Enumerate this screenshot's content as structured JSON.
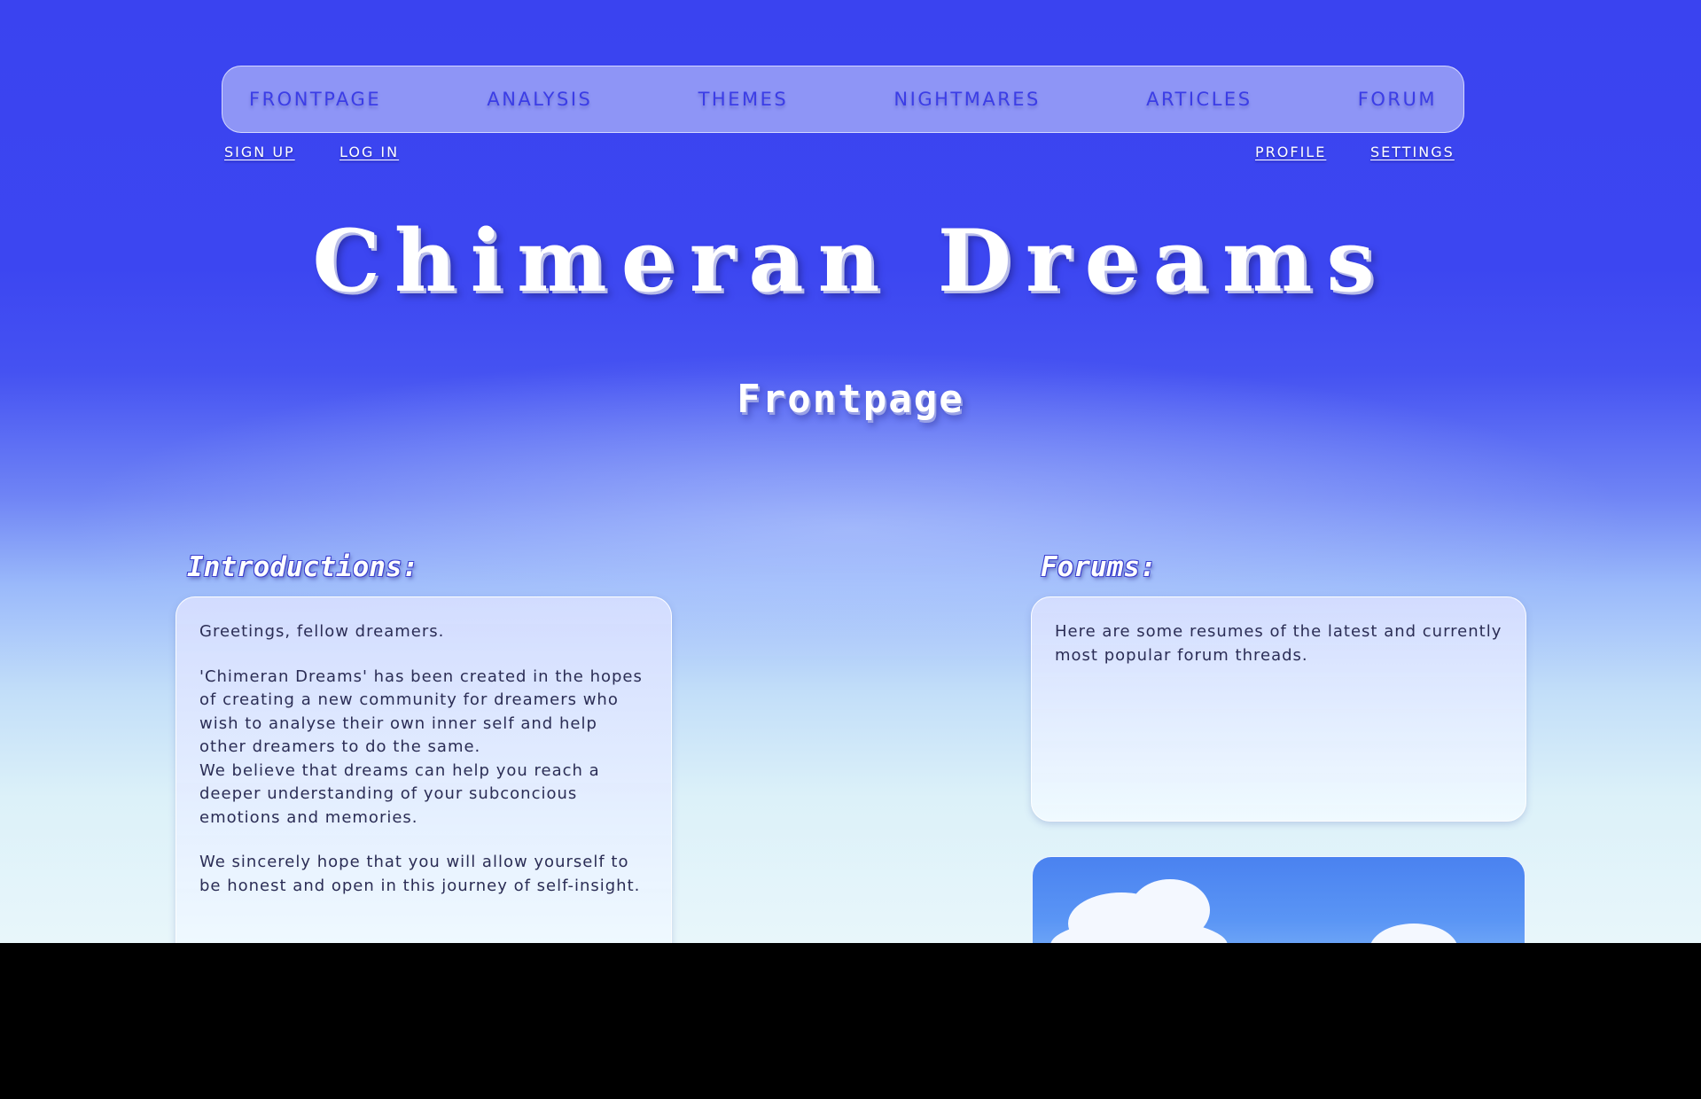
{
  "nav": {
    "items": [
      "FRONTPAGE",
      "ANALYSIS",
      "THEMES",
      "NIGHTMARES",
      "ARTICLES",
      "FORUM"
    ]
  },
  "account": {
    "sign_up": "SIGN UP",
    "log_in": "LOG IN",
    "profile": "PROFILE",
    "settings": "SETTINGS"
  },
  "header": {
    "site_title": "Chimeran Dreams",
    "page_title": "Frontpage"
  },
  "introductions": {
    "heading": "Introductions:",
    "greeting": "Greetings, fellow dreamers.",
    "paragraph_1": "'Chimeran Dreams' has been created in the hopes of creating a new community for dreamers who wish to analyse their own inner self and help other dreamers to do the same.",
    "paragraph_2": "We believe that dreams can help you reach a deeper understanding of your subconcious emotions and memories.",
    "paragraph_3": "We sincerely hope that you will allow yourself to be honest and open in this journey of self-insight."
  },
  "forums": {
    "heading": "Forums:",
    "intro": "Here are some resumes of the latest and currently most popular forum threads."
  },
  "colors": {
    "background_top": "#3a43f0",
    "background_bottom": "#e8f6fa",
    "nav_text": "#3b3de6",
    "card_text": "#2b2d55"
  }
}
